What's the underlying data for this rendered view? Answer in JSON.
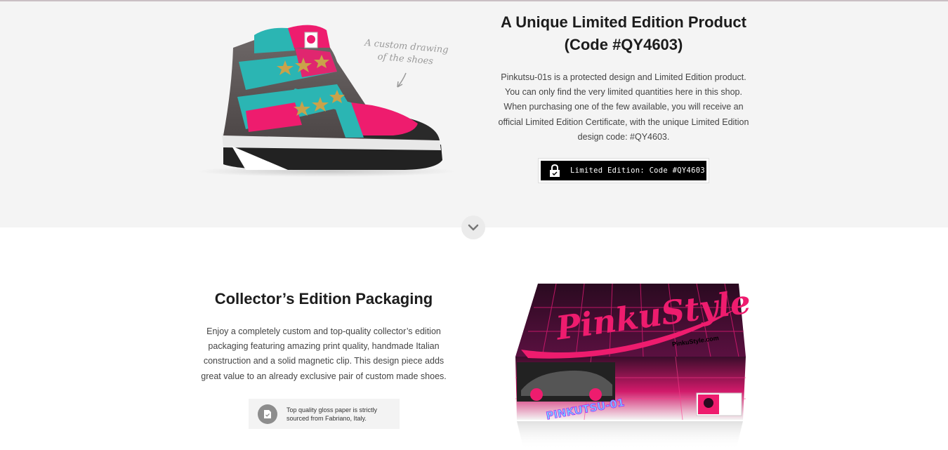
{
  "product": {
    "title_line1": "A Unique Limited Edition Product",
    "title_line2": "(Code #QY4603)",
    "description": "Pinkutsu-01s is a protected design and Limited Edition product. You can only find the very limited quantities here in this shop. When purchasing one of the few available, you will receive an official Limited Edition Certificate, with the unique Limited Edition design code: #QY4603.",
    "badge_label": "Limited Edition: Code #QY4603",
    "annotation_line1": "A custom drawing",
    "annotation_line2": "of the shoes"
  },
  "packaging": {
    "title": "Collector’s Edition Packaging",
    "description": "Enjoy a completely custom and top-quality collector’s edition packaging featuring amazing print quality, handmade Italian construction and a solid magnetic clip. This design piece adds great value to an already exclusive pair of custom made shoes.",
    "note": "Top quality gloss paper is strictly sourced from Fabriano, Italy.",
    "box_brand": "PinkuStyle",
    "box_url": "PinkuStyle.com",
    "box_model": "PINKUTSU-01"
  },
  "icons": {
    "lock": "lock-icon",
    "scroll": "chevron-down-icon",
    "document": "document-icon"
  },
  "colors": {
    "pink": "#ee1c6e",
    "teal": "#2bb5b3",
    "dark": "#1c1c1c"
  }
}
